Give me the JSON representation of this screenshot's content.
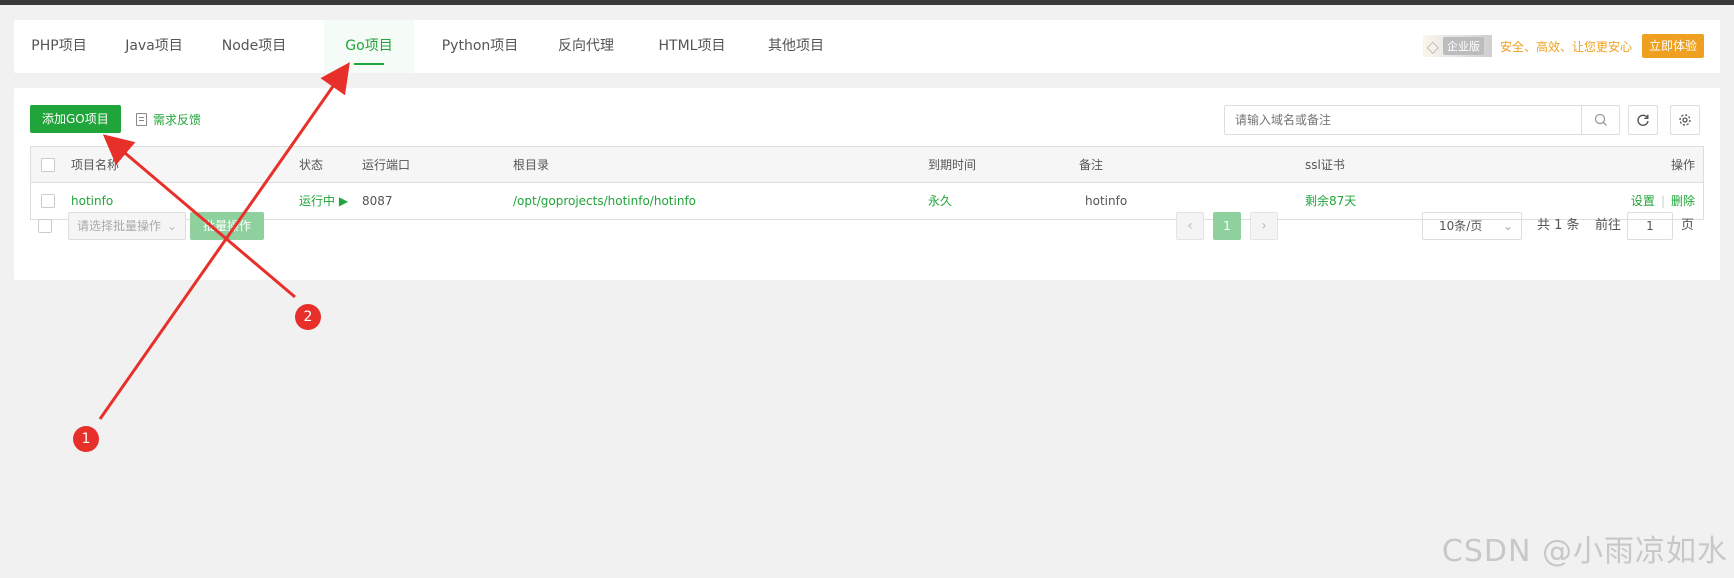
{
  "tabs": [
    {
      "label": "PHP项目"
    },
    {
      "label": "Java项目"
    },
    {
      "label": "Node项目"
    },
    {
      "label": "Go项目",
      "active": true
    },
    {
      "label": "Python项目"
    },
    {
      "label": "反向代理"
    },
    {
      "label": "HTML项目"
    },
    {
      "label": "其他项目"
    }
  ],
  "enterprise": {
    "badge": "企业版",
    "slogan": "安全、高效、让您更安心",
    "button": "立即体验"
  },
  "toolbar": {
    "add_button": "添加GO项目",
    "feedback": "需求反馈",
    "search_placeholder": "请输入域名或备注"
  },
  "table": {
    "headers": [
      "项目名称",
      "状态",
      "运行端口",
      "根目录",
      "到期时间",
      "备注",
      "ssl证书",
      "操作"
    ],
    "rows": [
      {
        "name": "hotinfo",
        "status": "运行中 ▶",
        "port": "8087",
        "root": "/opt/goprojects/hotinfo/hotinfo",
        "expire": "永久",
        "remark": "hotinfo",
        "ssl": "剩余87天",
        "action_settings": "设置",
        "action_delete": "删除"
      }
    ]
  },
  "footer": {
    "batch_placeholder": "请选择批量操作",
    "batch_button": "批量操作",
    "current_page": "1",
    "page_size": "10条/页",
    "total": "共 1 条",
    "goto_label": "前往",
    "goto_value": "1",
    "page_suffix": "页"
  },
  "annotations": {
    "badge_1": "1",
    "badge_2": "2"
  },
  "watermark": "CSDN @小雨凉如水",
  "colors": {
    "accent": "#20a53a",
    "enterprise": "#f0a020",
    "annotation": "#e8302a"
  }
}
